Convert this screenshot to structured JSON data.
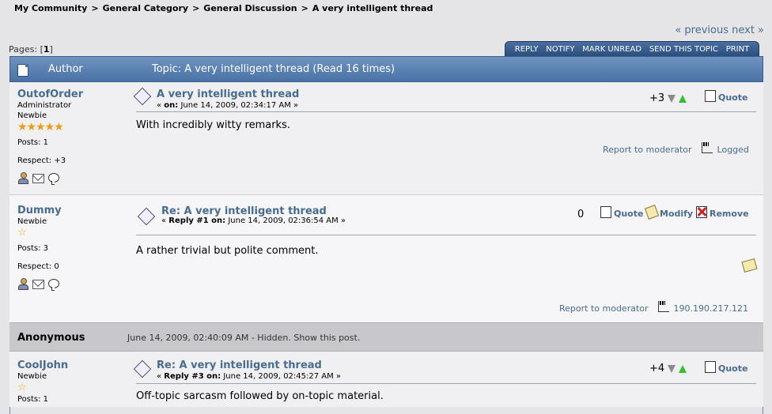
{
  "breadcrumb": [
    "My Community",
    "General Category",
    "General Discussion",
    "A very intelligent thread"
  ],
  "breadcrumb_sep": ">",
  "nav": {
    "prev_next": "« previous next »"
  },
  "pages": {
    "label": "Pages: [",
    "current": "1",
    "close": "]"
  },
  "tabs": [
    "REPLY",
    "NOTIFY",
    "MARK UNREAD",
    "SEND THIS TOPIC",
    "PRINT"
  ],
  "header": {
    "author": "Author",
    "topic": "Topic: A very intelligent thread  (Read 16 times)"
  },
  "posts": [
    {
      "name": "OutofOrder",
      "group": "Administrator",
      "post_group": "Newbie",
      "stars": "★★★★★",
      "posts": "Posts: 1",
      "respect": "Respect: +3",
      "subject": "A very intelligent thread",
      "meta_open": "« ",
      "meta_bold": "on:",
      "meta_text": " June 14, 2009, 02:34:17 AM »",
      "karma": "+3",
      "quote": "Quote",
      "body": "With incredibly witty remarks.",
      "report": "Report to moderator",
      "ip": "Logged"
    },
    {
      "name": "Dummy",
      "post_group": "Newbie",
      "stars": "☆",
      "posts": "Posts: 3",
      "respect": "Respect: 0",
      "subject": "Re: A very intelligent thread",
      "meta_open": "« ",
      "meta_bold": "Reply #1 on:",
      "meta_text": " June 14, 2009, 02:36:54 AM »",
      "karma": "0",
      "quote": "Quote",
      "modify": "Modify",
      "remove": "Remove",
      "body": "A rather trivial but polite comment.",
      "report": "Report to moderator",
      "ip": "190.190.217.121"
    },
    {
      "name": "CoolJohn",
      "post_group": "Newbie",
      "stars": "☆",
      "posts": "Posts: 1",
      "subject": "Re: A very intelligent thread",
      "meta_open": "« ",
      "meta_bold": "Reply #3 on:",
      "meta_text": " June 14, 2009, 02:45:27 AM »",
      "karma": "+4",
      "quote": "Quote",
      "body": "Off-topic sarcasm followed by on-topic material."
    }
  ],
  "hidden_post": {
    "name": "Anonymous",
    "info": "June 14, 2009, 02:40:09 AM - Hidden. Show this post."
  }
}
